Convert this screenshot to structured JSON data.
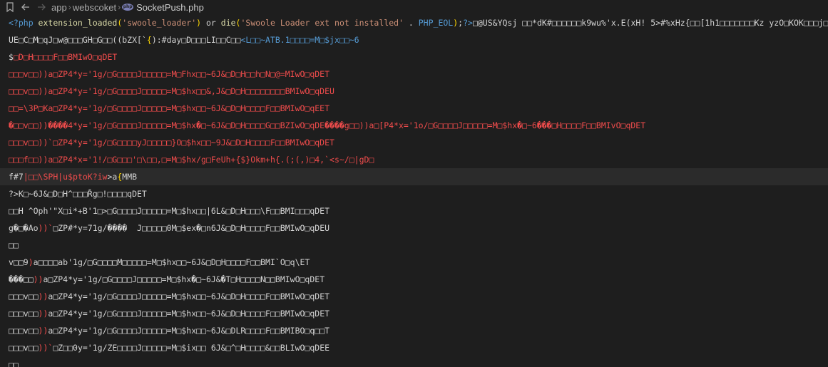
{
  "titlebar": {
    "breadcrumbs": [
      "app",
      "webscoket",
      "SocketPush.php"
    ],
    "separator": "›"
  },
  "lines": [
    {
      "current": false,
      "segments": [
        {
          "c": "tk-blue",
          "t": "<?php "
        },
        {
          "c": "tk-ident",
          "t": "extension_loaded"
        },
        {
          "c": "tk-gold",
          "t": "("
        },
        {
          "c": "tk-string",
          "t": "'swoole_loader'"
        },
        {
          "c": "tk-gold",
          "t": ")"
        },
        {
          "c": "tk-plain",
          "t": " or "
        },
        {
          "c": "tk-ident",
          "t": "die"
        },
        {
          "c": "tk-gold",
          "t": "("
        },
        {
          "c": "tk-string",
          "t": "'Swoole Loader ext not installed'"
        },
        {
          "c": "tk-plain",
          "t": " . "
        },
        {
          "c": "tk-blue",
          "t": "PHP_EOL"
        },
        {
          "c": "tk-gold",
          "t": ")"
        },
        {
          "c": "tk-plain",
          "t": ";"
        },
        {
          "c": "tk-blue",
          "t": "?>"
        },
        {
          "c": "tk-plain",
          "t": "□@US&YQsj □□*dK#□□□□□□k9wu%'x.E(xH! 5>#%xHz{□□[1h1□□□□□□□Kz yzO□KOK□□□j□□sj □□*dK"
        }
      ]
    },
    {
      "current": false,
      "segments": [
        {
          "c": "tk-plain",
          "t": "UE□C□M□qJ□w@□□□GH□G□□((bZX[`"
        },
        {
          "c": "tk-gold",
          "t": "{"
        },
        {
          "c": "tk-plain",
          "t": "):#day□D□□□LI□□C□□"
        },
        {
          "c": "tk-blue",
          "t": "<L□□~ATB.1□□□□=M□$jx□□~6"
        }
      ]
    },
    {
      "current": false,
      "segments": [
        {
          "c": "tk-plain",
          "t": "$"
        },
        {
          "c": "tk-red",
          "t": "□D□H□□□□F□□BMIwO□qDET"
        }
      ]
    },
    {
      "current": false,
      "segments": [
        {
          "c": "tk-red",
          "t": "□□□v□□))a□ZP4*y='1g/□G□□□□J□□□□□=M□Fhx□□~6J&□D□H□□h□N□@=MIwO□qDET"
        }
      ]
    },
    {
      "current": false,
      "segments": [
        {
          "c": "tk-red",
          "t": "□□□v□□))a□ZP4*y='1g/□G□□□□J□□□□□=M□$hx□□&,J&□D□H□□□□□□□□BMIwO□qDEU"
        }
      ]
    },
    {
      "current": false,
      "segments": [
        {
          "c": "tk-red",
          "t": "□□=\\3P□Ka□ZP4*y='1g/□G□□□□J□□□□□=M□$hx□□~6J&□D□H□□□□F□□BMIwO□qEET"
        }
      ]
    },
    {
      "current": false,
      "segments": [
        {
          "c": "tk-red",
          "t": "�□□v□□))����4*y='1g/□G□□□□J□□□□□=M□$hx�□~6J&□D□H□□□□G□□BZIwO□qDE����g□□))a□[P4*x='1o/□G□□□□J□□□□□=M□$hx�□~6���□H□□□□F□□BMIvO□qDET"
        }
      ]
    },
    {
      "current": false,
      "segments": [
        {
          "c": "tk-red",
          "t": "□□□v□□))`□ZP4*y='1g/□G□□□□yJ□□□□□}O□$hx□□~9J&□D□H□□□□F□□BMIwO□qDET"
        }
      ]
    },
    {
      "current": false,
      "segments": [
        {
          "c": "tk-red",
          "t": "□□□f□□))a□ZP4*x='1!/□G□□□'□\\□□,□=M□$hx/g□FeUh+{$}Okm+h{.(;(,)□4,`<s~/□|gD□"
        }
      ]
    },
    {
      "current": true,
      "segments": [
        {
          "c": "tk-plain",
          "t": "f#7"
        },
        {
          "c": "tk-red",
          "t": "|□□\\SPH|u$ptoK?iw"
        },
        {
          "c": "tk-plain",
          "t": ">a"
        },
        {
          "c": "tk-gold",
          "t": "{"
        },
        {
          "c": "tk-plain",
          "t": "MMB"
        }
      ]
    },
    {
      "current": false,
      "segments": [
        {
          "c": "tk-plain",
          "t": "?>K□~6J&□D□H^□□□Řg□!□□□□qDET"
        }
      ]
    },
    {
      "current": false,
      "segments": [
        {
          "c": "tk-plain",
          "t": "□□H ^Oph'\"X□i*+B'1□>□G□□□□J□□□□□=M□$hx□□|6L&□D□H□□□\\F□□BMI□□□qDET"
        }
      ]
    },
    {
      "current": false,
      "segments": [
        {
          "c": "tk-plain",
          "t": "g�□�Ao"
        },
        {
          "c": "tk-red",
          "t": "))`"
        },
        {
          "c": "tk-plain",
          "t": "□ZP#*y=71g/����  J□□□□□0M□$ex�□n6J&□D□H□□□□F□□BMIwO□qDEU"
        }
      ]
    },
    {
      "current": false,
      "segments": [
        {
          "c": "tk-plain",
          "t": "□□"
        }
      ]
    },
    {
      "current": false,
      "segments": [
        {
          "c": "tk-plain",
          "t": "v□□9"
        },
        {
          "c": "tk-red",
          "t": ")"
        },
        {
          "c": "tk-plain",
          "t": "a□□□□ab'1g/□G□□□□M□□□□□=M□$hx□□~6J&□D□H□□□□F□□BMI`O□q\\ET"
        }
      ]
    },
    {
      "current": false,
      "segments": [
        {
          "c": "tk-plain",
          "t": "���□□"
        },
        {
          "c": "tk-red",
          "t": "))"
        },
        {
          "c": "tk-plain",
          "t": "a□ZP4*y='1g/□G□□□□J□□□□□=M□$hx�□~6J&�T□H□□□□N□□BMIwO□qDET"
        }
      ]
    },
    {
      "current": false,
      "segments": [
        {
          "c": "tk-plain",
          "t": "□□□v□□"
        },
        {
          "c": "tk-red",
          "t": "))"
        },
        {
          "c": "tk-plain",
          "t": "a□ZP4*y='1g/□G□□□□J□□□□□=M□$hx□□~6J&□D□H□□□□F□□BMIwO□qDET"
        }
      ]
    },
    {
      "current": false,
      "segments": [
        {
          "c": "tk-plain",
          "t": "□□□v□□"
        },
        {
          "c": "tk-red",
          "t": "))"
        },
        {
          "c": "tk-plain",
          "t": "a□ZP4*y='1g/□G□□□□J□□□□□=M□$hx□□~6J&□D□H□□□□F□□BMIwO□qDET"
        }
      ]
    },
    {
      "current": false,
      "segments": [
        {
          "c": "tk-plain",
          "t": "□□□v□□"
        },
        {
          "c": "tk-red",
          "t": "))"
        },
        {
          "c": "tk-plain",
          "t": "a□ZP4*y='1g/□G□□□□J□□□□□=M□$hx□□~6J&□DLR□□□□F□□BMIBO□q□□T"
        }
      ]
    },
    {
      "current": false,
      "segments": [
        {
          "c": "tk-plain",
          "t": "□□□v□□"
        },
        {
          "c": "tk-red",
          "t": "))`"
        },
        {
          "c": "tk-plain",
          "t": "□Z□□0y='1g/ZE□□□□J□□□□□=M□$ix□□ 6J&□^□H□□□□&□□BLIwO□qDEE"
        }
      ]
    },
    {
      "current": false,
      "segments": [
        {
          "c": "tk-plain",
          "t": "□□"
        }
      ]
    }
  ]
}
